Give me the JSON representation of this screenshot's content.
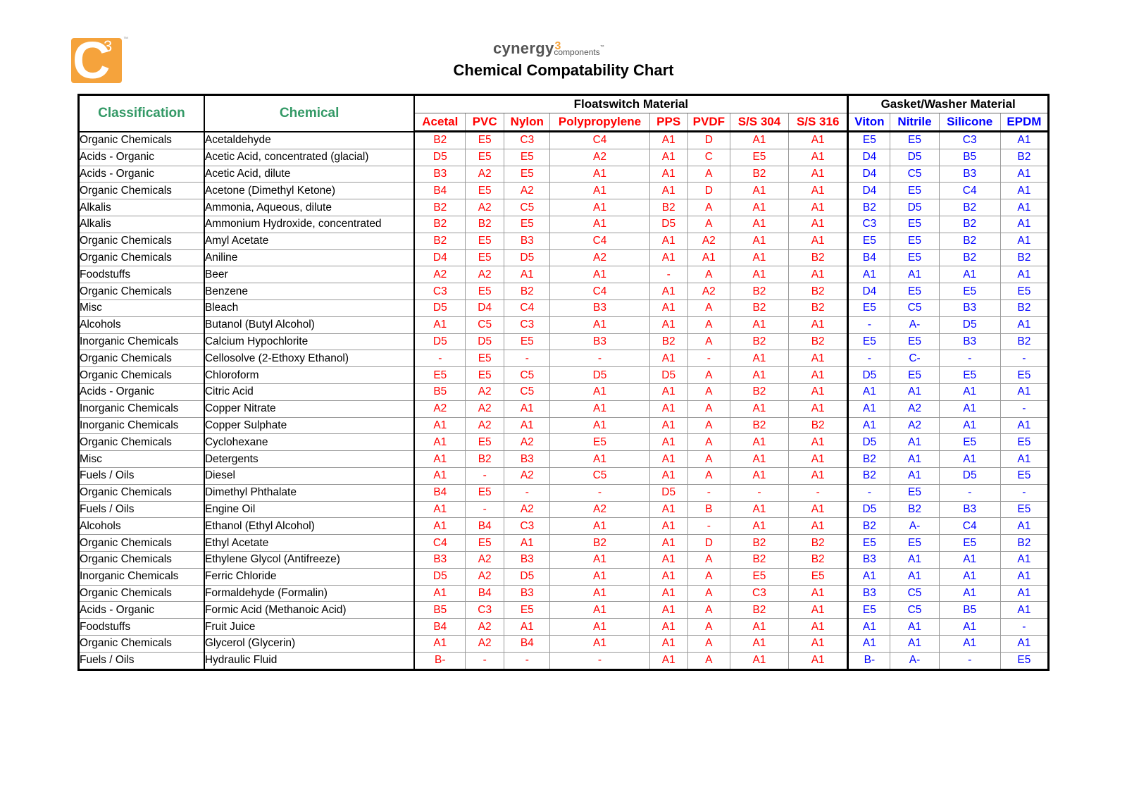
{
  "header": {
    "logo_letter": "C",
    "logo_superscript": "3",
    "logo_tm": "™",
    "brand_name": "cynergy",
    "brand_superscript": "3",
    "brand_sub": "components",
    "brand_tm": "™",
    "title": "Chemical Compatability Chart"
  },
  "table": {
    "col_classification": "Classification",
    "col_chemical": "Chemical",
    "group_floatswitch": "Floatswitch Material",
    "group_gasket": "Gasket/Washer Material",
    "floatswitch_materials": [
      "Acetal",
      "PVC",
      "Nylon",
      "Polypropylene",
      "PPS",
      "PVDF",
      "S/S 304",
      "S/S 316"
    ],
    "gasket_materials": [
      "Viton",
      "Nitrile",
      "Silicone",
      "EPDM"
    ],
    "rows": [
      {
        "classification": "Organic Chemicals",
        "chemical": "Acetaldehyde",
        "float": [
          "B2",
          "E5",
          "C3",
          "C4",
          "A1",
          "D",
          "A1",
          "A1"
        ],
        "gasket": [
          "E5",
          "E5",
          "C3",
          "A1"
        ]
      },
      {
        "classification": "Acids - Organic",
        "chemical": "Acetic Acid, concentrated (glacial)",
        "float": [
          "D5",
          "E5",
          "E5",
          "A2",
          "A1",
          "C",
          "E5",
          "A1"
        ],
        "gasket": [
          "D4",
          "D5",
          "B5",
          "B2"
        ]
      },
      {
        "classification": "Acids - Organic",
        "chemical": "Acetic Acid, dilute",
        "float": [
          "B3",
          "A2",
          "E5",
          "A1",
          "A1",
          "A",
          "B2",
          "A1"
        ],
        "gasket": [
          "D4",
          "C5",
          "B3",
          "A1"
        ]
      },
      {
        "classification": "Organic Chemicals",
        "chemical": "Acetone (Dimethyl Ketone)",
        "float": [
          "B4",
          "E5",
          "A2",
          "A1",
          "A1",
          "D",
          "A1",
          "A1"
        ],
        "gasket": [
          "D4",
          "E5",
          "C4",
          "A1"
        ]
      },
      {
        "classification": "Alkalis",
        "chemical": "Ammonia, Aqueous, dilute",
        "float": [
          "B2",
          "A2",
          "C5",
          "A1",
          "B2",
          "A",
          "A1",
          "A1"
        ],
        "gasket": [
          "B2",
          "D5",
          "B2",
          "A1"
        ]
      },
      {
        "classification": "Alkalis",
        "chemical": "Ammonium Hydroxide, concentrated",
        "float": [
          "B2",
          "B2",
          "E5",
          "A1",
          "D5",
          "A",
          "A1",
          "A1"
        ],
        "gasket": [
          "C3",
          "E5",
          "B2",
          "A1"
        ]
      },
      {
        "classification": "Organic Chemicals",
        "chemical": "Amyl Acetate",
        "float": [
          "B2",
          "E5",
          "B3",
          "C4",
          "A1",
          "A2",
          "A1",
          "A1"
        ],
        "gasket": [
          "E5",
          "E5",
          "B2",
          "A1"
        ]
      },
      {
        "classification": "Organic Chemicals",
        "chemical": "Aniline",
        "float": [
          "D4",
          "E5",
          "D5",
          "A2",
          "A1",
          "A1",
          "A1",
          "B2"
        ],
        "gasket": [
          "B4",
          "E5",
          "B2",
          "B2"
        ]
      },
      {
        "classification": "Foodstuffs",
        "chemical": "Beer",
        "float": [
          "A2",
          "A2",
          "A1",
          "A1",
          "-",
          "A",
          "A1",
          "A1"
        ],
        "gasket": [
          "A1",
          "A1",
          "A1",
          "A1"
        ]
      },
      {
        "classification": "Organic Chemicals",
        "chemical": "Benzene",
        "float": [
          "C3",
          "E5",
          "B2",
          "C4",
          "A1",
          "A2",
          "B2",
          "B2"
        ],
        "gasket": [
          "D4",
          "E5",
          "E5",
          "E5"
        ]
      },
      {
        "classification": "Misc",
        "chemical": "Bleach",
        "float": [
          "D5",
          "D4",
          "C4",
          "B3",
          "A1",
          "A",
          "B2",
          "B2"
        ],
        "gasket": [
          "E5",
          "C5",
          "B3",
          "B2"
        ]
      },
      {
        "classification": "Alcohols",
        "chemical": "Butanol (Butyl Alcohol)",
        "float": [
          "A1",
          "C5",
          "C3",
          "A1",
          "A1",
          "A",
          "A1",
          "A1"
        ],
        "gasket": [
          "-",
          "A-",
          "D5",
          "A1"
        ]
      },
      {
        "classification": "Inorganic Chemicals",
        "chemical": "Calcium Hypochlorite",
        "float": [
          "D5",
          "D5",
          "E5",
          "B3",
          "B2",
          "A",
          "B2",
          "B2"
        ],
        "gasket": [
          "E5",
          "E5",
          "B3",
          "B2"
        ]
      },
      {
        "classification": "Organic Chemicals",
        "chemical": "Cellosolve (2-Ethoxy Ethanol)",
        "float": [
          "-",
          "E5",
          "-",
          "-",
          "A1",
          "-",
          "A1",
          "A1"
        ],
        "gasket": [
          "-",
          "C-",
          "-",
          "-"
        ]
      },
      {
        "classification": "Organic Chemicals",
        "chemical": "Chloroform",
        "float": [
          "E5",
          "E5",
          "C5",
          "D5",
          "D5",
          "A",
          "A1",
          "A1"
        ],
        "gasket": [
          "D5",
          "E5",
          "E5",
          "E5"
        ]
      },
      {
        "classification": "Acids - Organic",
        "chemical": "Citric Acid",
        "float": [
          "B5",
          "A2",
          "C5",
          "A1",
          "A1",
          "A",
          "B2",
          "A1"
        ],
        "gasket": [
          "A1",
          "A1",
          "A1",
          "A1"
        ]
      },
      {
        "classification": "Inorganic Chemicals",
        "chemical": "Copper Nitrate",
        "float": [
          "A2",
          "A2",
          "A1",
          "A1",
          "A1",
          "A",
          "A1",
          "A1"
        ],
        "gasket": [
          "A1",
          "A2",
          "A1",
          "-"
        ]
      },
      {
        "classification": "Inorganic Chemicals",
        "chemical": "Copper Sulphate",
        "float": [
          "A1",
          "A2",
          "A1",
          "A1",
          "A1",
          "A",
          "B2",
          "B2"
        ],
        "gasket": [
          "A1",
          "A2",
          "A1",
          "A1"
        ]
      },
      {
        "classification": "Organic Chemicals",
        "chemical": "Cyclohexane",
        "float": [
          "A1",
          "E5",
          "A2",
          "E5",
          "A1",
          "A",
          "A1",
          "A1"
        ],
        "gasket": [
          "D5",
          "A1",
          "E5",
          "E5"
        ]
      },
      {
        "classification": "Misc",
        "chemical": "Detergents",
        "float": [
          "A1",
          "B2",
          "B3",
          "A1",
          "A1",
          "A",
          "A1",
          "A1"
        ],
        "gasket": [
          "B2",
          "A1",
          "A1",
          "A1"
        ]
      },
      {
        "classification": "Fuels / Oils",
        "chemical": "Diesel",
        "float": [
          "A1",
          "-",
          "A2",
          "C5",
          "A1",
          "A",
          "A1",
          "A1"
        ],
        "gasket": [
          "B2",
          "A1",
          "D5",
          "E5"
        ]
      },
      {
        "classification": "Organic Chemicals",
        "chemical": "Dimethyl Phthalate",
        "float": [
          "B4",
          "E5",
          "-",
          "-",
          "D5",
          "-",
          "-",
          "-"
        ],
        "gasket": [
          "-",
          "E5",
          "-",
          "-"
        ]
      },
      {
        "classification": "Fuels / Oils",
        "chemical": "Engine Oil",
        "float": [
          "A1",
          "-",
          "A2",
          "A2",
          "A1",
          "B",
          "A1",
          "A1"
        ],
        "gasket": [
          "D5",
          "B2",
          "B3",
          "E5"
        ]
      },
      {
        "classification": "Alcohols",
        "chemical": "Ethanol (Ethyl Alcohol)",
        "float": [
          "A1",
          "B4",
          "C3",
          "A1",
          "A1",
          "-",
          "A1",
          "A1"
        ],
        "gasket": [
          "B2",
          "A-",
          "C4",
          "A1"
        ]
      },
      {
        "classification": "Organic Chemicals",
        "chemical": "Ethyl Acetate",
        "float": [
          "C4",
          "E5",
          "A1",
          "B2",
          "A1",
          "D",
          "B2",
          "B2"
        ],
        "gasket": [
          "E5",
          "E5",
          "E5",
          "B2"
        ]
      },
      {
        "classification": "Organic Chemicals",
        "chemical": "Ethylene Glycol (Antifreeze)",
        "float": [
          "B3",
          "A2",
          "B3",
          "A1",
          "A1",
          "A",
          "B2",
          "B2"
        ],
        "gasket": [
          "B3",
          "A1",
          "A1",
          "A1"
        ]
      },
      {
        "classification": "Inorganic Chemicals",
        "chemical": "Ferric Chloride",
        "float": [
          "D5",
          "A2",
          "D5",
          "A1",
          "A1",
          "A",
          "E5",
          "E5"
        ],
        "gasket": [
          "A1",
          "A1",
          "A1",
          "A1"
        ]
      },
      {
        "classification": "Organic Chemicals",
        "chemical": "Formaldehyde (Formalin)",
        "float": [
          "A1",
          "B4",
          "B3",
          "A1",
          "A1",
          "A",
          "C3",
          "A1"
        ],
        "gasket": [
          "B3",
          "C5",
          "A1",
          "A1"
        ]
      },
      {
        "classification": "Acids - Organic",
        "chemical": "Formic Acid (Methanoic Acid)",
        "float": [
          "B5",
          "C3",
          "E5",
          "A1",
          "A1",
          "A",
          "B2",
          "A1"
        ],
        "gasket": [
          "E5",
          "C5",
          "B5",
          "A1"
        ]
      },
      {
        "classification": "Foodstuffs",
        "chemical": "Fruit Juice",
        "float": [
          "B4",
          "A2",
          "A1",
          "A1",
          "A1",
          "A",
          "A1",
          "A1"
        ],
        "gasket": [
          "A1",
          "A1",
          "A1",
          "-"
        ]
      },
      {
        "classification": "Organic Chemicals",
        "chemical": "Glycerol (Glycerin)",
        "float": [
          "A1",
          "A2",
          "B4",
          "A1",
          "A1",
          "A",
          "A1",
          "A1"
        ],
        "gasket": [
          "A1",
          "A1",
          "A1",
          "A1"
        ]
      },
      {
        "classification": "Fuels / Oils",
        "chemical": "Hydraulic Fluid",
        "float": [
          "B-",
          "-",
          "-",
          "-",
          "A1",
          "A",
          "A1",
          "A1"
        ],
        "gasket": [
          "B-",
          "A-",
          "-",
          "E5"
        ]
      }
    ]
  },
  "colors": {
    "logo_orange": "#f5a33c",
    "heading_green": "#339966",
    "floatswitch_red": "#ff0000",
    "gasket_blue": "#0000ff"
  }
}
